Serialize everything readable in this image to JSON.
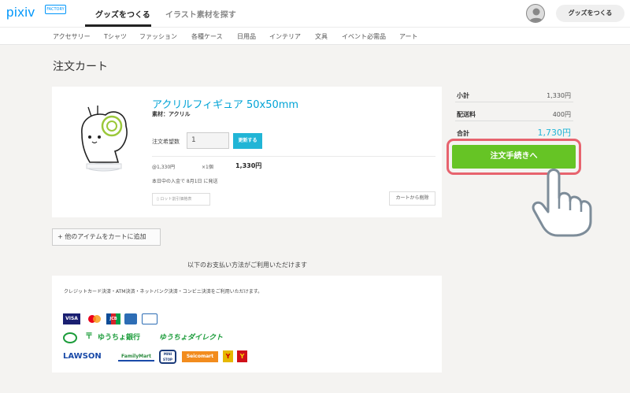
{
  "header": {
    "logo": "pixiv",
    "logo_badge": "FACTORY",
    "tabs": [
      "グッズをつくる",
      "イラスト素材を探す"
    ],
    "make_goods_button": "グッズをつくる"
  },
  "categories": [
    "アクセサリー",
    "Tシャツ",
    "ファッション",
    "各種ケース",
    "日用品",
    "インテリア",
    "文具",
    "イベント必需品",
    "アート"
  ],
  "page_title": "注文カート",
  "cart_item": {
    "title": "アクリルフィギュア 50x50mm",
    "material": "素材：アクリル",
    "qty_label": "注文希望数",
    "qty_value": "1",
    "update_button": "更新する",
    "unit_price": "@1,330円",
    "multiplier": "×1個",
    "line_total": "1,330円",
    "shipping_note": "本日中の入金で 8月1日 に発送",
    "lot_button": "ロット割引価格表",
    "remove_button": "カートから削除"
  },
  "summary": {
    "subtotal_label": "小計",
    "subtotal": "1,330円",
    "shipping_label": "配送料",
    "shipping": "400円",
    "total_label": "合計",
    "total": "1,730円",
    "checkout_button": "注文手続きへ"
  },
  "add_item_button": "+ 他のアイテムをカートに追加",
  "payment": {
    "heading": "以下のお支払い方法がご利用いただけます",
    "description": "クレジットカード決済・ATM決済・ネットバンク決済・コンビニ決済をご利用いただけます。",
    "logos": {
      "visa": "VISA",
      "jcb": "JCB",
      "yucho_bank": "ゆうちょ銀行",
      "yucho_direct": "ゆうちょダイレクト",
      "lawson": "LAWSON",
      "familymart": "FamilyMart",
      "ministop": "MINI STOP",
      "seicomart": "Seicomart"
    }
  },
  "colors": {
    "accent": "#21b5d6",
    "checkout": "#66c425",
    "highlight": "#e7636e"
  }
}
